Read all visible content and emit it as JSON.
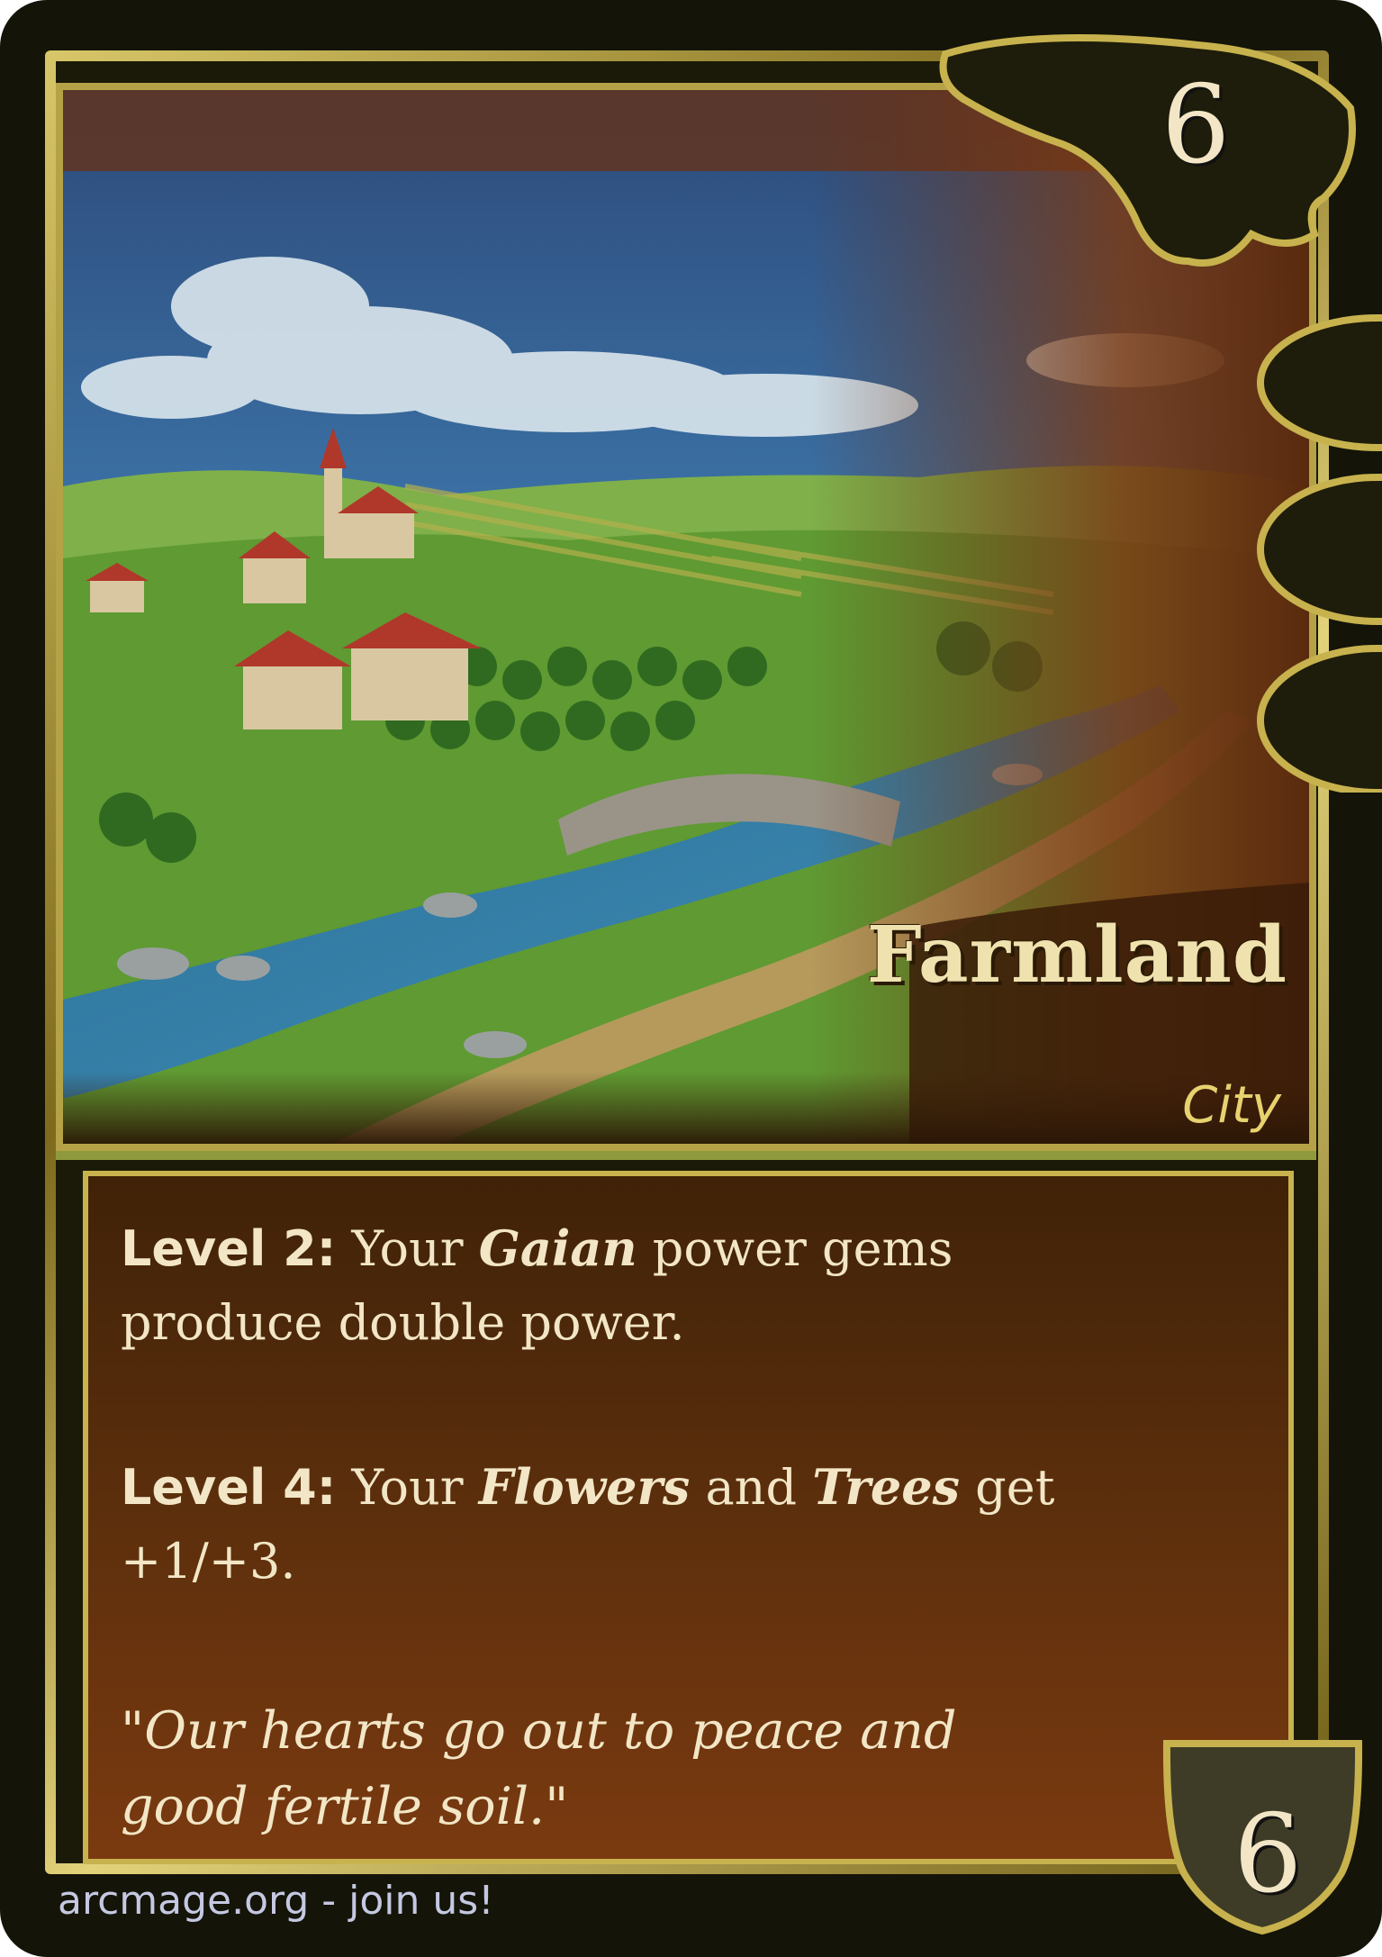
{
  "card": {
    "name": "Farmland",
    "type": "City",
    "cost": "6",
    "defense": "6",
    "rules": [
      {
        "level": "Level 2:",
        "parts": [
          "Your ",
          "Gaian",
          " power gems produce double power."
        ]
      },
      {
        "level": "Level 4:",
        "parts": [
          "Your ",
          "Flowers",
          " and ",
          "Trees",
          " get +1/+3."
        ]
      }
    ],
    "flavor": "\"Our hearts go out to peace and good fertile soil.\"",
    "footer": "arcmage.org - join us!"
  },
  "colors": {
    "frame_gold": "#c7b24e",
    "text_cream": "#f2e6c6",
    "type_yellow": "#e7d26f",
    "panel_brown": "#5a2e0c"
  }
}
